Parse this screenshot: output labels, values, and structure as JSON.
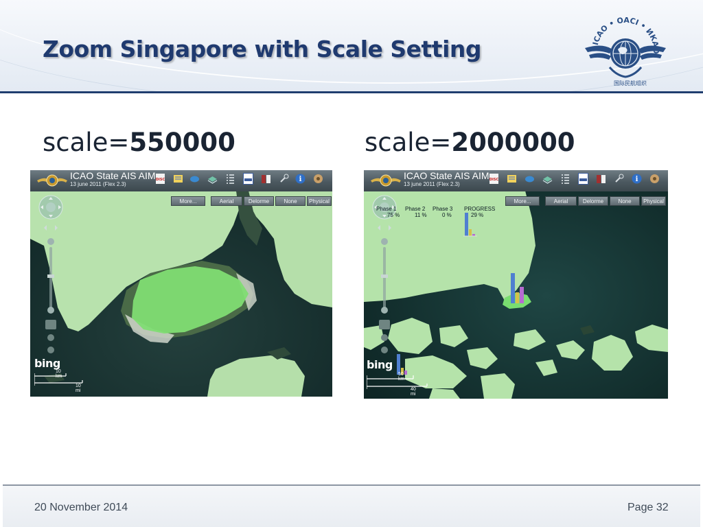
{
  "slide": {
    "title": "Zoom Singapore with Scale Setting",
    "date": "20 November 2014",
    "page": "Page 32",
    "logo_icon": "icao-emblem-icon"
  },
  "panels": [
    {
      "scale_prefix": "scale=",
      "scale_value": "550000",
      "app_title": "ICAO State AIS AIM",
      "app_subtitle": "13 june 2011 (Flex 2.3)",
      "map_buttons": [
        "More...",
        "Aerial",
        "Delorme",
        "None",
        "Physical"
      ],
      "bing": "bing",
      "scale_km": "10 km",
      "scale_mi": "10 mi"
    },
    {
      "scale_prefix": "scale=",
      "scale_value": "2000000",
      "app_title": "ICAO State AIS AIM",
      "app_subtitle": "13 june 2011 (Flex 2.3)",
      "map_buttons": [
        "More...",
        "Aerial",
        "Delorme",
        "None",
        "Physical"
      ],
      "bing": "bing",
      "scale_km": "50 km",
      "scale_mi": "40 mi",
      "progress": {
        "headers": [
          "Phase 1",
          "Phase 2",
          "Phase 3",
          "PROGRESS"
        ],
        "values": [
          "75 %",
          "11 %",
          "0 %",
          "29 %"
        ]
      }
    }
  ],
  "colors": {
    "title": "#1f3a6f",
    "rule": "#1f3d6e",
    "highlight_green": "#7fe07a",
    "overlay_green": "#b7e6b0",
    "water": "#0f2a2a"
  }
}
